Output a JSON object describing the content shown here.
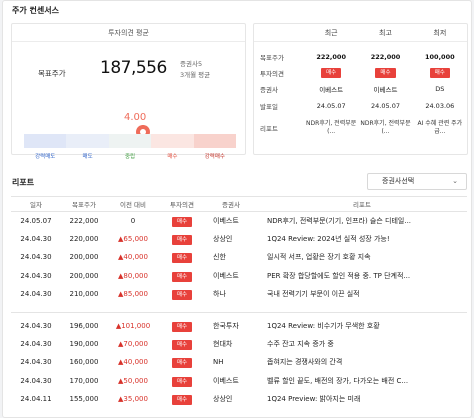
{
  "section_title": "주가 컨센서스",
  "consensus": {
    "header": "투자의견 평균",
    "target_label": "목표주가",
    "target_value": "187,556",
    "meta_line1": "증권사5",
    "meta_line2": "3개월 평균",
    "score": "4.00",
    "score_level": 4,
    "gauge_labels": [
      "강력매도",
      "매도",
      "중립",
      "매수",
      "강력매수"
    ],
    "gauge_label_colors": [
      "#2f63c9",
      "#2f63c9",
      "#3a9a3a",
      "#e24b3b",
      "#c22f25"
    ],
    "gauge_colors": [
      "#dfe6f7",
      "#e9eef8",
      "#eef3f2",
      "#fbe6e2",
      "#f8d2cc"
    ]
  },
  "comparison": {
    "columns": [
      "최근",
      "최고",
      "최저"
    ],
    "rows": {
      "target_price": {
        "label": "목표주가",
        "values": [
          "222,000",
          "222,000",
          "100,000"
        ]
      },
      "opinion": {
        "label": "투자의견",
        "values": [
          "매수",
          "매수",
          "매수"
        ]
      },
      "broker": {
        "label": "증권사",
        "values": [
          "이베스트",
          "이베스트",
          "DS"
        ]
      },
      "date": {
        "label": "발표일",
        "values": [
          "24.05.07",
          "24.05.07",
          "24.03.06"
        ]
      },
      "report": {
        "label": "리포트",
        "values": [
          "NDR후기, 전력부문(...",
          "NDR후기, 전력부문(...",
          "AI 수혜 관련 주가 급..."
        ]
      }
    }
  },
  "reports": {
    "title": "리포트",
    "select_label": "증권사선택",
    "headers": [
      "일자",
      "목표주가",
      "이전 대비",
      "투자의견",
      "증권사",
      "리포트"
    ],
    "group1": [
      {
        "date": "24.05.07",
        "tp": "222,000",
        "chg": "0",
        "op": "매수",
        "broker": "이베스트",
        "report": "NDR후기, 전력부문(기기, 인프라) 슬슨 디테일..."
      },
      {
        "date": "24.04.30",
        "tp": "220,000",
        "chg": "▲65,000",
        "op": "매수",
        "broker": "상상인",
        "report": "1Q24 Review: 2024년 실적 성장 가능!"
      },
      {
        "date": "24.04.30",
        "tp": "200,000",
        "chg": "▲40,000",
        "op": "매수",
        "broker": "신한",
        "report": "일시적 서프, 업황은 장기 호황 지속"
      },
      {
        "date": "24.04.30",
        "tp": "200,000",
        "chg": "▲80,000",
        "op": "매수",
        "broker": "이베스트",
        "report": "PER 확장 합당할에도 할인 적용 중. TP 단계적..."
      },
      {
        "date": "24.04.30",
        "tp": "210,000",
        "chg": "▲85,000",
        "op": "매수",
        "broker": "하나",
        "report": "국내 전력기기 부문이 이끈 실적"
      }
    ],
    "group2": [
      {
        "date": "24.04.30",
        "tp": "196,000",
        "chg": "▲101,000",
        "op": "매수",
        "broker": "한국투자",
        "report": "1Q24 Review: 비수기가 무색한 호황"
      },
      {
        "date": "24.04.30",
        "tp": "190,000",
        "chg": "▲70,000",
        "op": "매수",
        "broker": "현대차",
        "report": "수주 잔고 지속 증가 중"
      },
      {
        "date": "24.04.30",
        "tp": "160,000",
        "chg": "▲40,000",
        "op": "매수",
        "broker": "NH",
        "report": "좁혀지는 경쟁사와의 간격"
      },
      {
        "date": "24.04.30",
        "tp": "170,000",
        "chg": "▲50,000",
        "op": "매수",
        "broker": "이베스트",
        "report": "벨류 할인 끝도, 배전의 장가, 다가오는 배전 C..."
      },
      {
        "date": "24.04.11",
        "tp": "155,000",
        "chg": "▲35,000",
        "op": "매수",
        "broker": "상상인",
        "report": "1Q24 Preview: 밝아지는 미래"
      }
    ]
  }
}
